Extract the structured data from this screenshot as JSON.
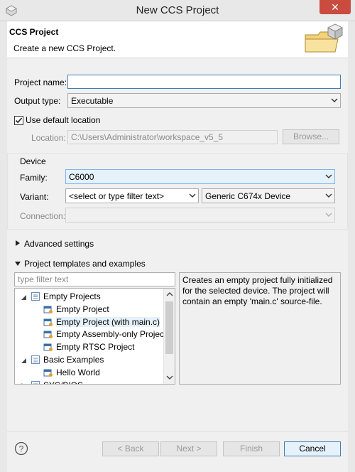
{
  "window": {
    "title": "New CCS Project",
    "close_glyph": "✕"
  },
  "header": {
    "title": "CCS Project",
    "description": "Create a new CCS Project."
  },
  "project_name": {
    "label": "Project name:",
    "value": ""
  },
  "output_type": {
    "label": "Output type:",
    "value": "Executable"
  },
  "location": {
    "checkbox_label": "Use default location",
    "checked": true,
    "label": "Location:",
    "value": "C:\\Users\\Administrator\\workspace_v5_5",
    "browse_label": "Browse..."
  },
  "device": {
    "group_label": "Device",
    "family_label": "Family:",
    "family_value": "C6000",
    "variant_label": "Variant:",
    "variant_filter": "<select or type filter text>",
    "variant_value": "Generic C674x Device",
    "connection_label": "Connection:",
    "connection_value": ""
  },
  "advanced": {
    "label": "Advanced settings"
  },
  "templates": {
    "label": "Project templates and examples",
    "filter_placeholder": "type filter text",
    "tree": [
      {
        "label": "Empty Projects",
        "level": 0,
        "expanded": true,
        "icon": "folder-icon"
      },
      {
        "label": "Empty Project",
        "level": 1,
        "icon": "project-template-icon"
      },
      {
        "label": "Empty Project (with main.c)",
        "level": 1,
        "icon": "project-template-icon",
        "selected": true
      },
      {
        "label": "Empty Assembly-only Project",
        "level": 1,
        "icon": "project-template-icon"
      },
      {
        "label": "Empty RTSC Project",
        "level": 1,
        "icon": "project-template-icon"
      },
      {
        "label": "Basic Examples",
        "level": 0,
        "expanded": true,
        "icon": "folder-icon"
      },
      {
        "label": "Hello World",
        "level": 1,
        "icon": "project-template-icon"
      },
      {
        "label": "SYS/BIOS",
        "level": 0,
        "expanded": false,
        "icon": "folder-icon"
      }
    ],
    "description": "Creates an empty project fully initialized for the selected device. The project will contain an empty 'main.c' source-file."
  },
  "buttons": {
    "back": "< Back",
    "next": "Next >",
    "finish": "Finish",
    "cancel": "Cancel"
  },
  "colors": {
    "accent": "#3c7fb1",
    "close": "#c94c3f",
    "selection": "#e5f1fb"
  }
}
